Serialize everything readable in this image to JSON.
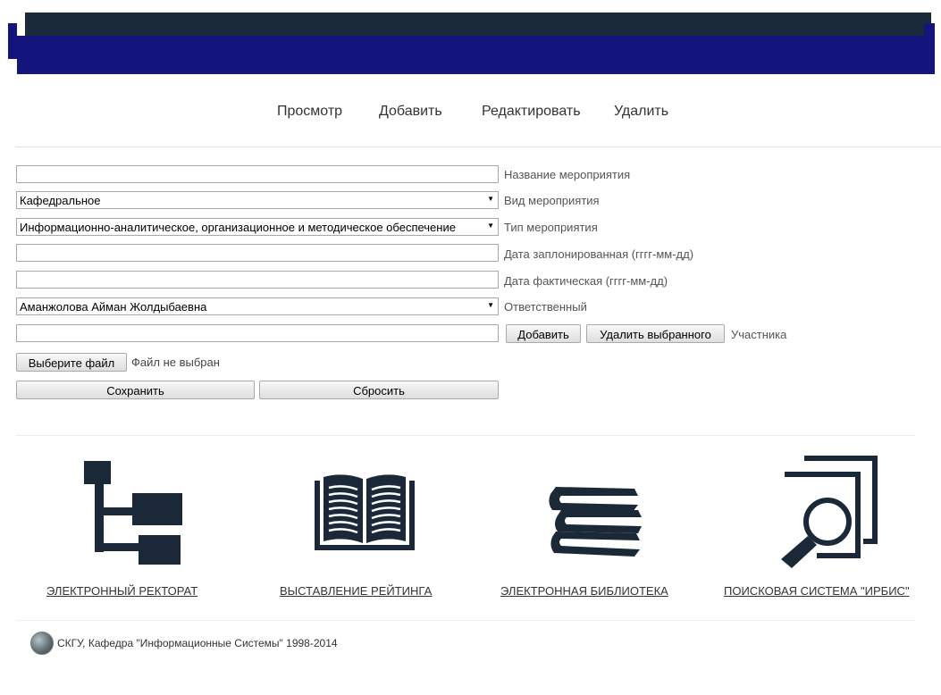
{
  "nav": {
    "items": [
      "Просмотр",
      "Добавить",
      "Редактировать",
      "Удалить"
    ]
  },
  "form": {
    "event_name": {
      "value": "",
      "label": "Название мероприятия"
    },
    "event_kind": {
      "selected": "Кафедральное",
      "label": "Вид мероприятия"
    },
    "event_type": {
      "selected": "Информационно-аналитическое, организационное и методическое обеспечение",
      "label": "Тип мероприятия"
    },
    "date_planned": {
      "value": "",
      "label": "Дата заплонированная (гггг-мм-дд)"
    },
    "date_actual": {
      "value": "",
      "label": "Дата фактическая (гггг-мм-дд)"
    },
    "responsible": {
      "selected": "Аманжолова Айман Жолдыбаевна",
      "label": "Ответственный"
    },
    "participant": {
      "value": "",
      "add_label": "Добавить",
      "remove_label": "Удалить выбранного",
      "label": "Участника"
    },
    "file": {
      "button_label": "Выберите файл",
      "status": "Файл не выбран"
    },
    "save_label": "Сохранить",
    "reset_label": "Сбросить"
  },
  "portals": [
    {
      "label": "ЭЛЕКТРОННЫЙ РЕКТОРАТ",
      "icon": "org-structure-icon"
    },
    {
      "label": "ВЫСТАВЛЕНИЕ РЕЙТИНГА",
      "icon": "open-book-icon"
    },
    {
      "label": "ЭЛЕКТРОННАЯ БИБЛИОТЕКА",
      "icon": "books-stack-icon"
    },
    {
      "label": "ПОИСКОВАЯ СИСТЕМА \"ИРБИС\"",
      "icon": "document-search-icon"
    }
  ],
  "footer": {
    "text": "СКГУ, Кафедра \"Информационные Системы\" 1998-2014"
  },
  "colors": {
    "header_dark": "#1a2a3a",
    "header_blue": "#14147d",
    "icon": "#1b2838"
  }
}
